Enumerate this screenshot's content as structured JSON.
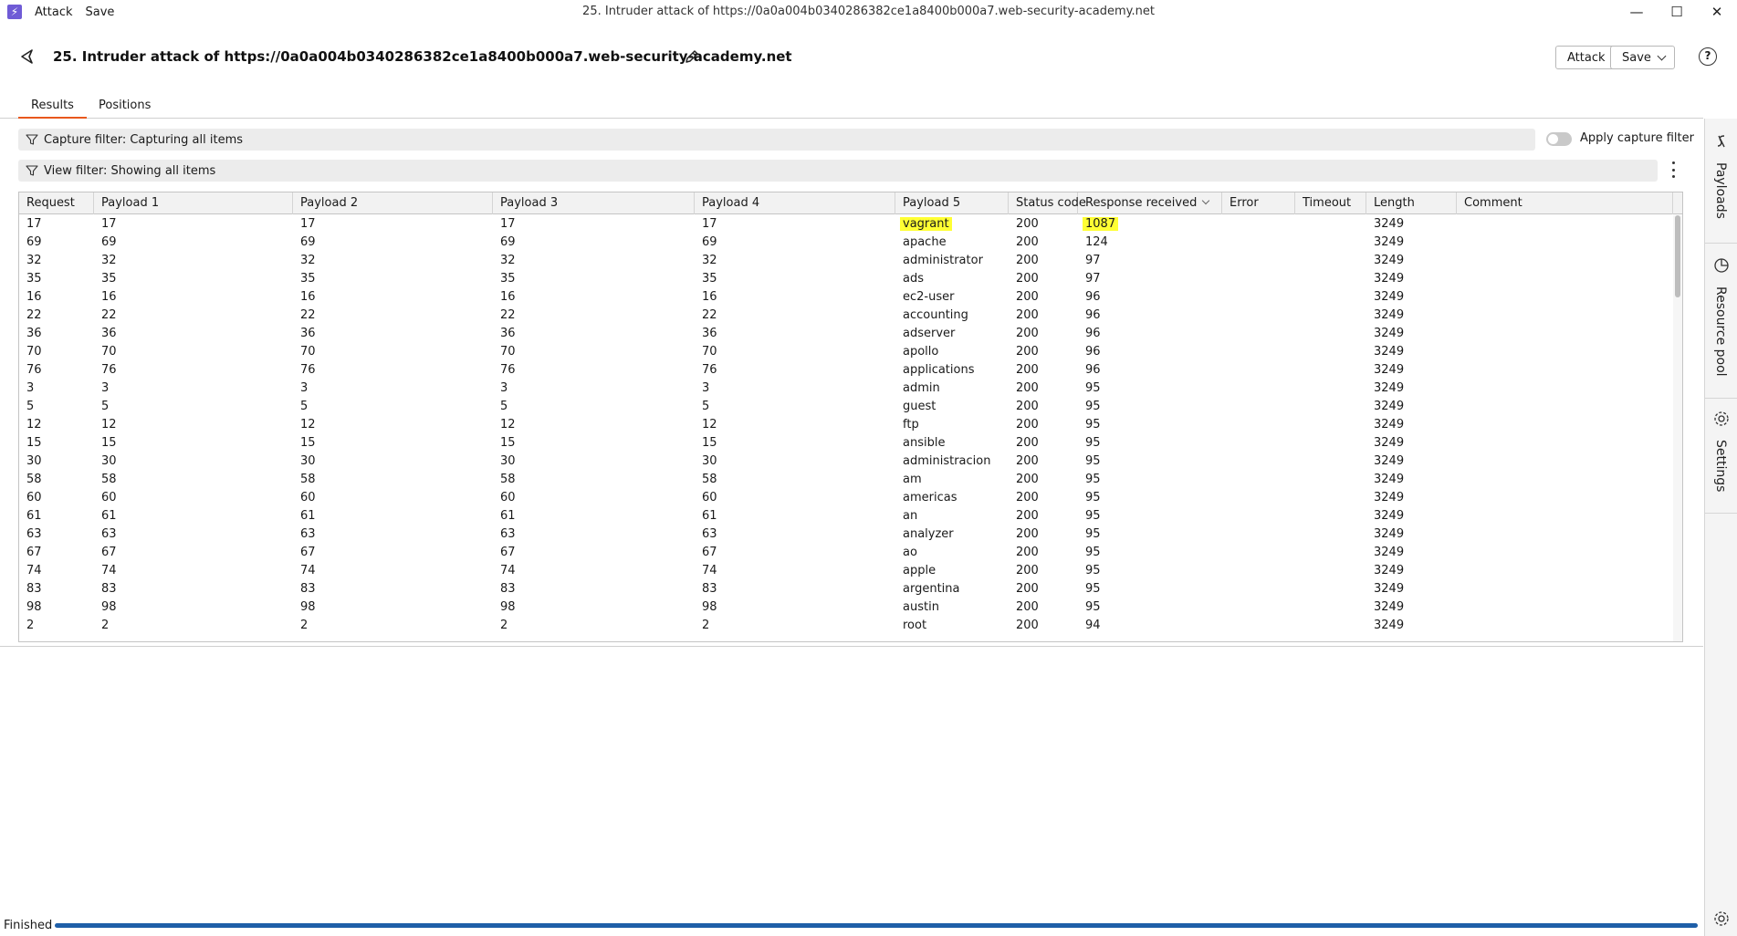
{
  "menu": {
    "attack": "Attack",
    "save": "Save"
  },
  "window_title": "25. Intruder attack of https://0a0a004b0340286382ce1a8400b000a7.web-security-academy.net",
  "header": {
    "title": "25. Intruder attack of https://0a0a004b0340286382ce1a8400b000a7.web-security-academy.net",
    "attack_btn": "Attack",
    "save_btn": "Save",
    "help": "?"
  },
  "tabs": [
    "Results",
    "Positions"
  ],
  "filters": {
    "capture": "Capture filter: Capturing all items",
    "view": "View filter: Showing all items",
    "apply_capture": "Apply capture filter"
  },
  "sidebar": [
    "Payloads",
    "Resource pool",
    "Settings"
  ],
  "table": {
    "columns": [
      "Request",
      "Payload 1",
      "Payload 2",
      "Payload 3",
      "Payload 4",
      "Payload 5",
      "Status code",
      "Response received",
      "Error",
      "Timeout",
      "Length",
      "Comment"
    ],
    "rows": [
      [
        "17",
        "17",
        "17",
        "17",
        "17",
        "vagrant",
        "200",
        "1087",
        "",
        "",
        "3249",
        ""
      ],
      [
        "69",
        "69",
        "69",
        "69",
        "69",
        "apache",
        "200",
        "124",
        "",
        "",
        "3249",
        ""
      ],
      [
        "32",
        "32",
        "32",
        "32",
        "32",
        "administrator",
        "200",
        "97",
        "",
        "",
        "3249",
        ""
      ],
      [
        "35",
        "35",
        "35",
        "35",
        "35",
        "ads",
        "200",
        "97",
        "",
        "",
        "3249",
        ""
      ],
      [
        "16",
        "16",
        "16",
        "16",
        "16",
        "ec2-user",
        "200",
        "96",
        "",
        "",
        "3249",
        ""
      ],
      [
        "22",
        "22",
        "22",
        "22",
        "22",
        "accounting",
        "200",
        "96",
        "",
        "",
        "3249",
        ""
      ],
      [
        "36",
        "36",
        "36",
        "36",
        "36",
        "adserver",
        "200",
        "96",
        "",
        "",
        "3249",
        ""
      ],
      [
        "70",
        "70",
        "70",
        "70",
        "70",
        "apollo",
        "200",
        "96",
        "",
        "",
        "3249",
        ""
      ],
      [
        "76",
        "76",
        "76",
        "76",
        "76",
        "applications",
        "200",
        "96",
        "",
        "",
        "3249",
        ""
      ],
      [
        "3",
        "3",
        "3",
        "3",
        "3",
        "admin",
        "200",
        "95",
        "",
        "",
        "3249",
        ""
      ],
      [
        "5",
        "5",
        "5",
        "5",
        "5",
        "guest",
        "200",
        "95",
        "",
        "",
        "3249",
        ""
      ],
      [
        "12",
        "12",
        "12",
        "12",
        "12",
        "ftp",
        "200",
        "95",
        "",
        "",
        "3249",
        ""
      ],
      [
        "15",
        "15",
        "15",
        "15",
        "15",
        "ansible",
        "200",
        "95",
        "",
        "",
        "3249",
        ""
      ],
      [
        "30",
        "30",
        "30",
        "30",
        "30",
        "administracion",
        "200",
        "95",
        "",
        "",
        "3249",
        ""
      ],
      [
        "58",
        "58",
        "58",
        "58",
        "58",
        "am",
        "200",
        "95",
        "",
        "",
        "3249",
        ""
      ],
      [
        "60",
        "60",
        "60",
        "60",
        "60",
        "americas",
        "200",
        "95",
        "",
        "",
        "3249",
        ""
      ],
      [
        "61",
        "61",
        "61",
        "61",
        "61",
        "an",
        "200",
        "95",
        "",
        "",
        "3249",
        ""
      ],
      [
        "63",
        "63",
        "63",
        "63",
        "63",
        "analyzer",
        "200",
        "95",
        "",
        "",
        "3249",
        ""
      ],
      [
        "67",
        "67",
        "67",
        "67",
        "67",
        "ao",
        "200",
        "95",
        "",
        "",
        "3249",
        ""
      ],
      [
        "74",
        "74",
        "74",
        "74",
        "74",
        "apple",
        "200",
        "95",
        "",
        "",
        "3249",
        ""
      ],
      [
        "83",
        "83",
        "83",
        "83",
        "83",
        "argentina",
        "200",
        "95",
        "",
        "",
        "3249",
        ""
      ],
      [
        "98",
        "98",
        "98",
        "98",
        "98",
        "austin",
        "200",
        "95",
        "",
        "",
        "3249",
        ""
      ],
      [
        "2",
        "2",
        "2",
        "2",
        "2",
        "root",
        "200",
        "94",
        "",
        "",
        "3249",
        ""
      ]
    ],
    "highlighted_row": 0,
    "highlight_color": "#ffff33"
  },
  "status": {
    "text": "Finished",
    "progress": 1.0
  },
  "colors": {
    "accent": "#e8581c",
    "progress": "#1f5fa8",
    "logo": "#6f5bd6"
  }
}
